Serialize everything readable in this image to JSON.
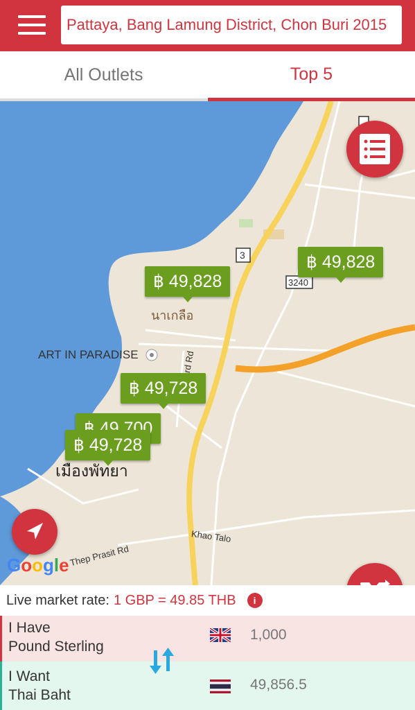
{
  "header": {
    "search_value": "Pattaya, Bang Lamung District, Chon Buri 2015",
    "menu_icon": "hamburger-menu-icon"
  },
  "tabs": [
    {
      "label": "All Outlets",
      "active": false
    },
    {
      "label": "Top 5",
      "active": true
    }
  ],
  "map": {
    "markers": [
      {
        "price": "฿ 49,828"
      },
      {
        "price": "฿ 49,828"
      },
      {
        "price": "฿ 49,728"
      },
      {
        "price": "฿ 49,700"
      },
      {
        "price": "฿ 49,728"
      }
    ],
    "labels": {
      "art_in_paradise": "ART IN PARADISE",
      "naklua": "นาเกลือ",
      "muang_pattaya": "เมืองพัทยา",
      "khao_talo": "Khao Talo",
      "thep_prasit": "Thep Prasit Rd",
      "third_rd": "3rd Rd",
      "route_3": "3",
      "route_3240": "3240"
    },
    "attribution": "Google"
  },
  "rate": {
    "label": "Live market rate:",
    "value": "1 GBP = 49.85 THB",
    "info_icon": "info-icon"
  },
  "have": {
    "line1": "I Have",
    "line2": "Pound Sterling",
    "amount": "1,000",
    "flag": "uk-flag-icon"
  },
  "want": {
    "line1": "I Want",
    "line2": "Thai Baht",
    "amount": "49,856.5",
    "flag": "thailand-flag-icon"
  },
  "colors": {
    "brand": "#d1343e",
    "marker": "#6b9e1f",
    "swap": "#29a9e0",
    "want_accent": "#27b394"
  }
}
